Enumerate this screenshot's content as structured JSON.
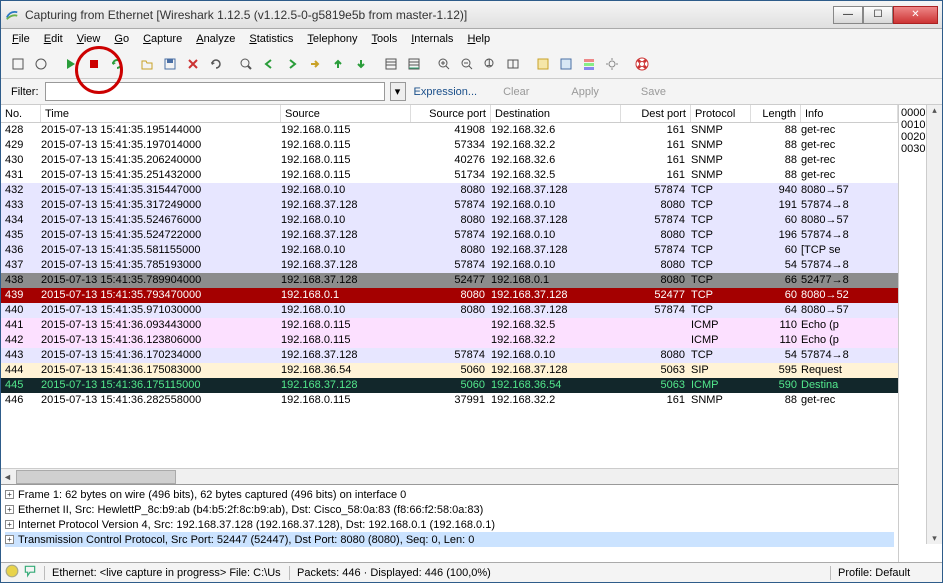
{
  "title": "Capturing from Ethernet   [Wireshark 1.12.5  (v1.12.5-0-g5819e5b from master-1.12)]",
  "menus": [
    "File",
    "Edit",
    "View",
    "Go",
    "Capture",
    "Analyze",
    "Statistics",
    "Telephony",
    "Tools",
    "Internals",
    "Help"
  ],
  "filter": {
    "label": "Filter:",
    "value": "",
    "expression": "Expression...",
    "clear": "Clear",
    "apply": "Apply",
    "save": "Save"
  },
  "columns": [
    "No.",
    "Time",
    "Source",
    "Source port",
    "Destination",
    "Dest port",
    "Protocol",
    "Length",
    "Info"
  ],
  "rows": [
    {
      "cls": "snmp",
      "no": "428",
      "time": "2015-07-13 15:41:35.195144000",
      "src": "192.168.0.115",
      "sport": "41908",
      "dst": "192.168.32.6",
      "dport": "161",
      "proto": "SNMP",
      "len": "88",
      "info": "get-rec"
    },
    {
      "cls": "snmp",
      "no": "429",
      "time": "2015-07-13 15:41:35.197014000",
      "src": "192.168.0.115",
      "sport": "57334",
      "dst": "192.168.32.2",
      "dport": "161",
      "proto": "SNMP",
      "len": "88",
      "info": "get-rec"
    },
    {
      "cls": "snmp",
      "no": "430",
      "time": "2015-07-13 15:41:35.206240000",
      "src": "192.168.0.115",
      "sport": "40276",
      "dst": "192.168.32.6",
      "dport": "161",
      "proto": "SNMP",
      "len": "88",
      "info": "get-rec"
    },
    {
      "cls": "snmp",
      "no": "431",
      "time": "2015-07-13 15:41:35.251432000",
      "src": "192.168.0.115",
      "sport": "51734",
      "dst": "192.168.32.5",
      "dport": "161",
      "proto": "SNMP",
      "len": "88",
      "info": "get-rec"
    },
    {
      "cls": "tcp",
      "no": "432",
      "time": "2015-07-13 15:41:35.315447000",
      "src": "192.168.0.10",
      "sport": "8080",
      "dst": "192.168.37.128",
      "dport": "57874",
      "proto": "TCP",
      "len": "940",
      "info": "8080→57"
    },
    {
      "cls": "tcp",
      "no": "433",
      "time": "2015-07-13 15:41:35.317249000",
      "src": "192.168.37.128",
      "sport": "57874",
      "dst": "192.168.0.10",
      "dport": "8080",
      "proto": "TCP",
      "len": "191",
      "info": "57874→8"
    },
    {
      "cls": "tcp",
      "no": "434",
      "time": "2015-07-13 15:41:35.524676000",
      "src": "192.168.0.10",
      "sport": "8080",
      "dst": "192.168.37.128",
      "dport": "57874",
      "proto": "TCP",
      "len": "60",
      "info": "8080→57"
    },
    {
      "cls": "tcp",
      "no": "435",
      "time": "2015-07-13 15:41:35.524722000",
      "src": "192.168.37.128",
      "sport": "57874",
      "dst": "192.168.0.10",
      "dport": "8080",
      "proto": "TCP",
      "len": "196",
      "info": "57874→8"
    },
    {
      "cls": "tcp",
      "no": "436",
      "time": "2015-07-13 15:41:35.581155000",
      "src": "192.168.0.10",
      "sport": "8080",
      "dst": "192.168.37.128",
      "dport": "57874",
      "proto": "TCP",
      "len": "60",
      "info": "[TCP se"
    },
    {
      "cls": "tcp",
      "no": "437",
      "time": "2015-07-13 15:41:35.785193000",
      "src": "192.168.37.128",
      "sport": "57874",
      "dst": "192.168.0.10",
      "dport": "8080",
      "proto": "TCP",
      "len": "54",
      "info": "57874→8"
    },
    {
      "cls": "sel-grey",
      "no": "438",
      "time": "2015-07-13 15:41:35.789904000",
      "src": "192.168.37.128",
      "sport": "52477",
      "dst": "192.168.0.1",
      "dport": "8080",
      "proto": "TCP",
      "len": "66",
      "info": "52477→8"
    },
    {
      "cls": "sel-red",
      "no": "439",
      "time": "2015-07-13 15:41:35.793470000",
      "src": "192.168.0.1",
      "sport": "8080",
      "dst": "192.168.37.128",
      "dport": "52477",
      "proto": "TCP",
      "len": "60",
      "info": "8080→52"
    },
    {
      "cls": "tcp",
      "no": "440",
      "time": "2015-07-13 15:41:35.971030000",
      "src": "192.168.0.10",
      "sport": "8080",
      "dst": "192.168.37.128",
      "dport": "57874",
      "proto": "TCP",
      "len": "64",
      "info": "8080→57"
    },
    {
      "cls": "icmp",
      "no": "441",
      "time": "2015-07-13 15:41:36.093443000",
      "src": "192.168.0.115",
      "sport": "",
      "dst": "192.168.32.5",
      "dport": "",
      "proto": "ICMP",
      "len": "110",
      "info": "Echo (p"
    },
    {
      "cls": "icmp",
      "no": "442",
      "time": "2015-07-13 15:41:36.123806000",
      "src": "192.168.0.115",
      "sport": "",
      "dst": "192.168.32.2",
      "dport": "",
      "proto": "ICMP",
      "len": "110",
      "info": "Echo (p"
    },
    {
      "cls": "tcp",
      "no": "443",
      "time": "2015-07-13 15:41:36.170234000",
      "src": "192.168.37.128",
      "sport": "57874",
      "dst": "192.168.0.10",
      "dport": "8080",
      "proto": "TCP",
      "len": "54",
      "info": "57874→8"
    },
    {
      "cls": "sip",
      "no": "444",
      "time": "2015-07-13 15:41:36.175083000",
      "src": "192.168.36.54",
      "sport": "5060",
      "dst": "192.168.37.128",
      "dport": "5063",
      "proto": "SIP",
      "len": "595",
      "info": "Request"
    },
    {
      "cls": "icmp-dark",
      "no": "445",
      "time": "2015-07-13 15:41:36.175115000",
      "src": "192.168.37.128",
      "sport": "5060",
      "dst": "192.168.36.54",
      "dport": "5063",
      "proto": "ICMP",
      "len": "590",
      "info": "Destina"
    },
    {
      "cls": "snmp",
      "no": "446",
      "time": "2015-07-13 15:41:36.282558000",
      "src": "192.168.0.115",
      "sport": "37991",
      "dst": "192.168.32.2",
      "dport": "161",
      "proto": "SNMP",
      "len": "88",
      "info": "get-rec"
    }
  ],
  "hexside": [
    "0000",
    "0010",
    "0020",
    "0030"
  ],
  "tree": [
    "Frame 1: 62 bytes on wire (496 bits), 62 bytes captured (496 bits) on interface 0",
    "Ethernet II, Src: HewlettP_8c:b9:ab (b4:b5:2f:8c:b9:ab), Dst: Cisco_58:0a:83 (f8:66:f2:58:0a:83)",
    "Internet Protocol Version 4, Src: 192.168.37.128 (192.168.37.128), Dst: 192.168.0.1 (192.168.0.1)",
    "Transmission Control Protocol, Src Port: 52447 (52447), Dst Port: 8080 (8080), Seq: 0, Len: 0"
  ],
  "status": {
    "capture": "Ethernet: <live capture in progress> File: C:\\Us",
    "packets": "Packets: 446 · Displayed: 446 (100,0%)",
    "profile": "Profile: Default"
  }
}
